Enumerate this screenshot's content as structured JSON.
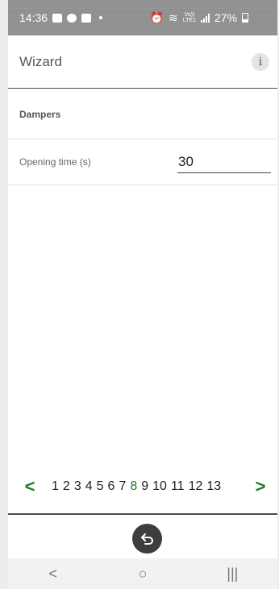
{
  "status_bar": {
    "time": "14:36",
    "battery_percent": "27%",
    "network_label": "LTE1",
    "volte_label": "Vo))"
  },
  "header": {
    "title": "Wizard",
    "info_glyph": "i"
  },
  "section": {
    "title": "Dampers"
  },
  "field": {
    "label": "Opening time  (s)",
    "value": "30"
  },
  "pager": {
    "prev_glyph": "<",
    "next_glyph": ">",
    "pages": [
      "1",
      "2",
      "3",
      "4",
      "5",
      "6",
      "7",
      "8",
      "9",
      "10",
      "11",
      "12",
      "13"
    ],
    "current_page": "8"
  },
  "nav_bar": {
    "back_glyph": "<",
    "home_glyph": "○",
    "recents_glyph": "|||"
  },
  "colors": {
    "accent_green": "#1e7d1e",
    "status_bar_bg": "#8f8f8f",
    "fab_bg": "#3d3d3d"
  },
  "icons": {
    "back_fab": "undo-arrow-icon",
    "info": "info-icon"
  }
}
